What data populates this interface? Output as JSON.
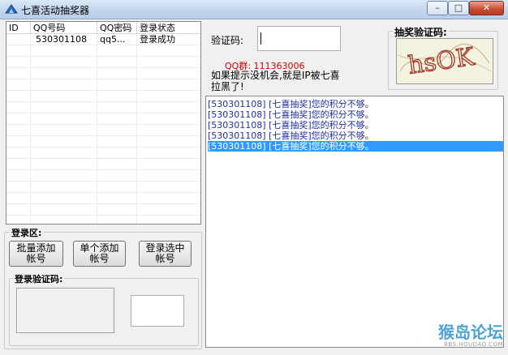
{
  "window": {
    "title": "七喜活动抽奖器",
    "min_glyph": "–",
    "max_glyph": "□",
    "close_glyph": "✕"
  },
  "accounts": {
    "columns": [
      "ID",
      "QQ号码",
      "QQ密码",
      "登录状态"
    ],
    "rows": [
      {
        "id": "",
        "qq": "530301108",
        "pwd": "qq5...",
        "status": "登录成功"
      }
    ]
  },
  "login_area": {
    "title": "登录区:",
    "batch_add_label": [
      "批量添加",
      "帐号"
    ],
    "single_add_label": [
      "单个添加",
      "帐号"
    ],
    "login_selected_label": [
      "登录选中",
      "帐号"
    ],
    "captcha_title": "登录验证码:"
  },
  "captcha_input": {
    "label": "验证码:",
    "value": ""
  },
  "qq_group": {
    "text": "QQ群: 111363006",
    "color": "#cc0000"
  },
  "notice": {
    "line1": "如果提示没机会,就是IP被七喜",
    "line2": "拉黑了!"
  },
  "lottery_captcha": {
    "title": "抽奖验证码:",
    "code_text": "hsOK"
  },
  "log": {
    "lines": [
      "[530301108]  [七喜抽奖]您的积分不够。",
      "[530301108]  [七喜抽奖]您的积分不够。",
      "[530301108]  [七喜抽奖]您的积分不够。",
      "[530301108]  [七喜抽奖]您的积分不够。",
      "[530301108]  [七喜抽奖]您的积分不够。"
    ],
    "selected_index": 4
  },
  "watermark": {
    "text": "猴岛论坛",
    "sub": "BBS.HOUDAO.COM"
  },
  "colors": {
    "log_text": "#1f2f9e",
    "selection": "#3399ff",
    "captcha_bg": "#f4f3df",
    "captcha_ink": "#a03a2a"
  }
}
